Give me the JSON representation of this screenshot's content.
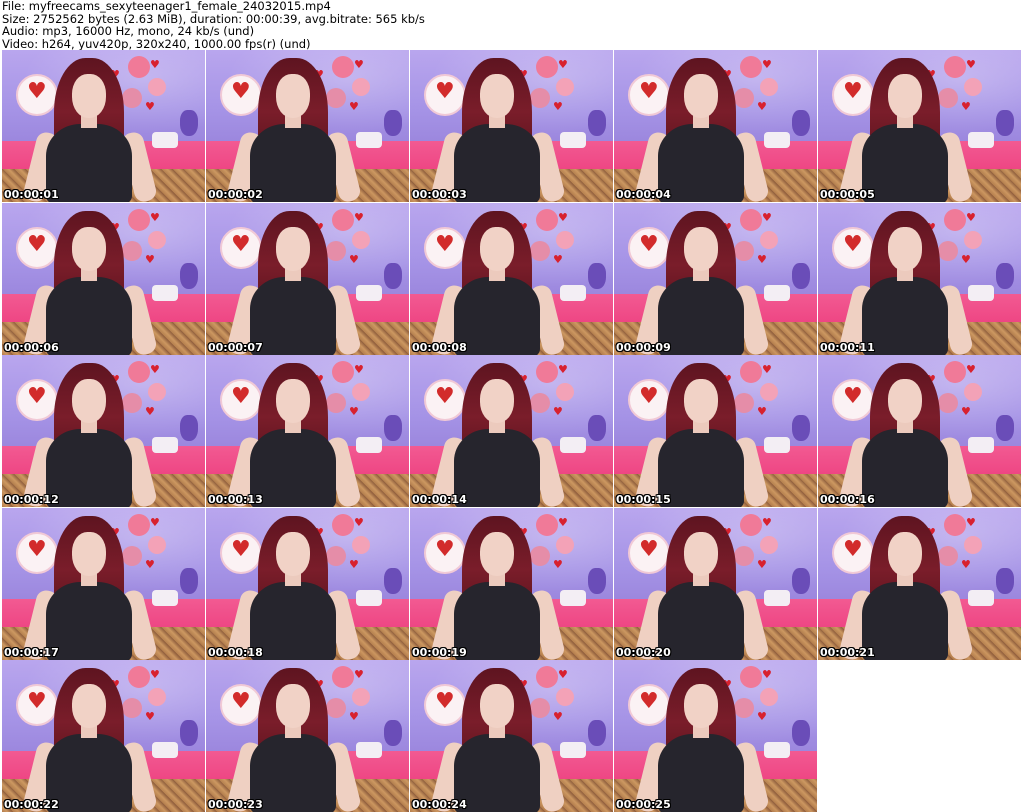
{
  "header": {
    "line1": "File: myfreecams_sexyteenager1_female_24032015.mp4",
    "line2": "Size: 2752562 bytes (2.63 MiB), duration: 00:00:39, avg.bitrate: 565 kb/s",
    "line3": "Audio: mp3, 16000 Hz, mono, 24 kb/s (und)",
    "line4": "Video: h264, yuv420p, 320x240, 1000.00 fps(r) (und)"
  },
  "thumbnails": [
    {
      "timestamp": "00:00:01"
    },
    {
      "timestamp": "00:00:02"
    },
    {
      "timestamp": "00:00:03"
    },
    {
      "timestamp": "00:00:04"
    },
    {
      "timestamp": "00:00:05"
    },
    {
      "timestamp": "00:00:06"
    },
    {
      "timestamp": "00:00:07"
    },
    {
      "timestamp": "00:00:08"
    },
    {
      "timestamp": "00:00:09"
    },
    {
      "timestamp": "00:00:11"
    },
    {
      "timestamp": "00:00:12"
    },
    {
      "timestamp": "00:00:13"
    },
    {
      "timestamp": "00:00:14"
    },
    {
      "timestamp": "00:00:15"
    },
    {
      "timestamp": "00:00:16"
    },
    {
      "timestamp": "00:00:17"
    },
    {
      "timestamp": "00:00:18"
    },
    {
      "timestamp": "00:00:19"
    },
    {
      "timestamp": "00:00:20"
    },
    {
      "timestamp": "00:00:21"
    },
    {
      "timestamp": "00:00:22"
    },
    {
      "timestamp": "00:00:23"
    },
    {
      "timestamp": "00:00:24"
    },
    {
      "timestamp": "00:00:25"
    }
  ]
}
